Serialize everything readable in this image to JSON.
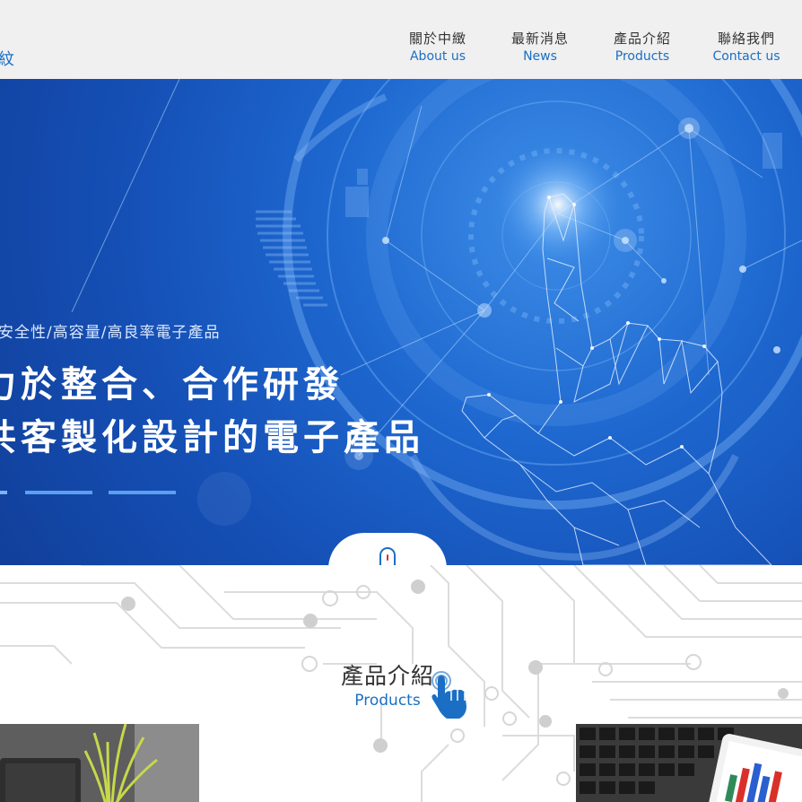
{
  "header": {
    "logo_fragment": "紋",
    "nav": [
      {
        "zh": "關於中緻",
        "en": "About us"
      },
      {
        "zh": "最新消息",
        "en": "News"
      },
      {
        "zh": "產品介紹",
        "en": "Products"
      },
      {
        "zh": "聯絡我們",
        "en": "Contact us"
      }
    ]
  },
  "hero": {
    "subtitle": "安全性/高容量/高良率電子產品",
    "headline_line1": "力於整合、合作研發",
    "headline_line2": "共客製化設計的電子產品",
    "slide_count": 3,
    "active_slide": 1
  },
  "section": {
    "title": "產品介紹",
    "subtitle": "Products"
  },
  "icons": [
    "mouse-scroll-icon",
    "pointing-hand-icon"
  ],
  "colors": {
    "accent_blue": "#1a6fc4",
    "hero_blue": "#1550b6",
    "header_bg": "#f0f0f0"
  }
}
